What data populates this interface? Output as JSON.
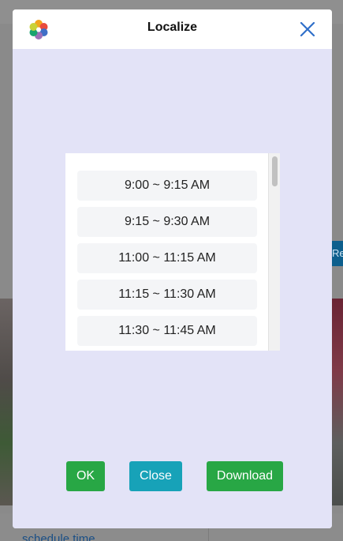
{
  "background": {
    "right_button_label": "Rec",
    "bottom_link": "schedule time"
  },
  "modal": {
    "title": "Localize",
    "logo_icon": "flower-logo-icon",
    "close_icon": "close-icon",
    "time_slots": [
      "9:00 ~ 9:15 AM",
      "9:15 ~ 9:30 AM",
      "11:00 ~ 11:15 AM",
      "11:15 ~ 11:30 AM",
      "11:30 ~ 11:45 AM"
    ],
    "buttons": {
      "ok": "OK",
      "close": "Close",
      "download": "Download"
    }
  },
  "colors": {
    "modal_body": "#e3e3f7",
    "ok_button": "#28a745",
    "close_button": "#17a2b8",
    "download_button": "#28a745",
    "close_x": "#2f6fc9"
  }
}
